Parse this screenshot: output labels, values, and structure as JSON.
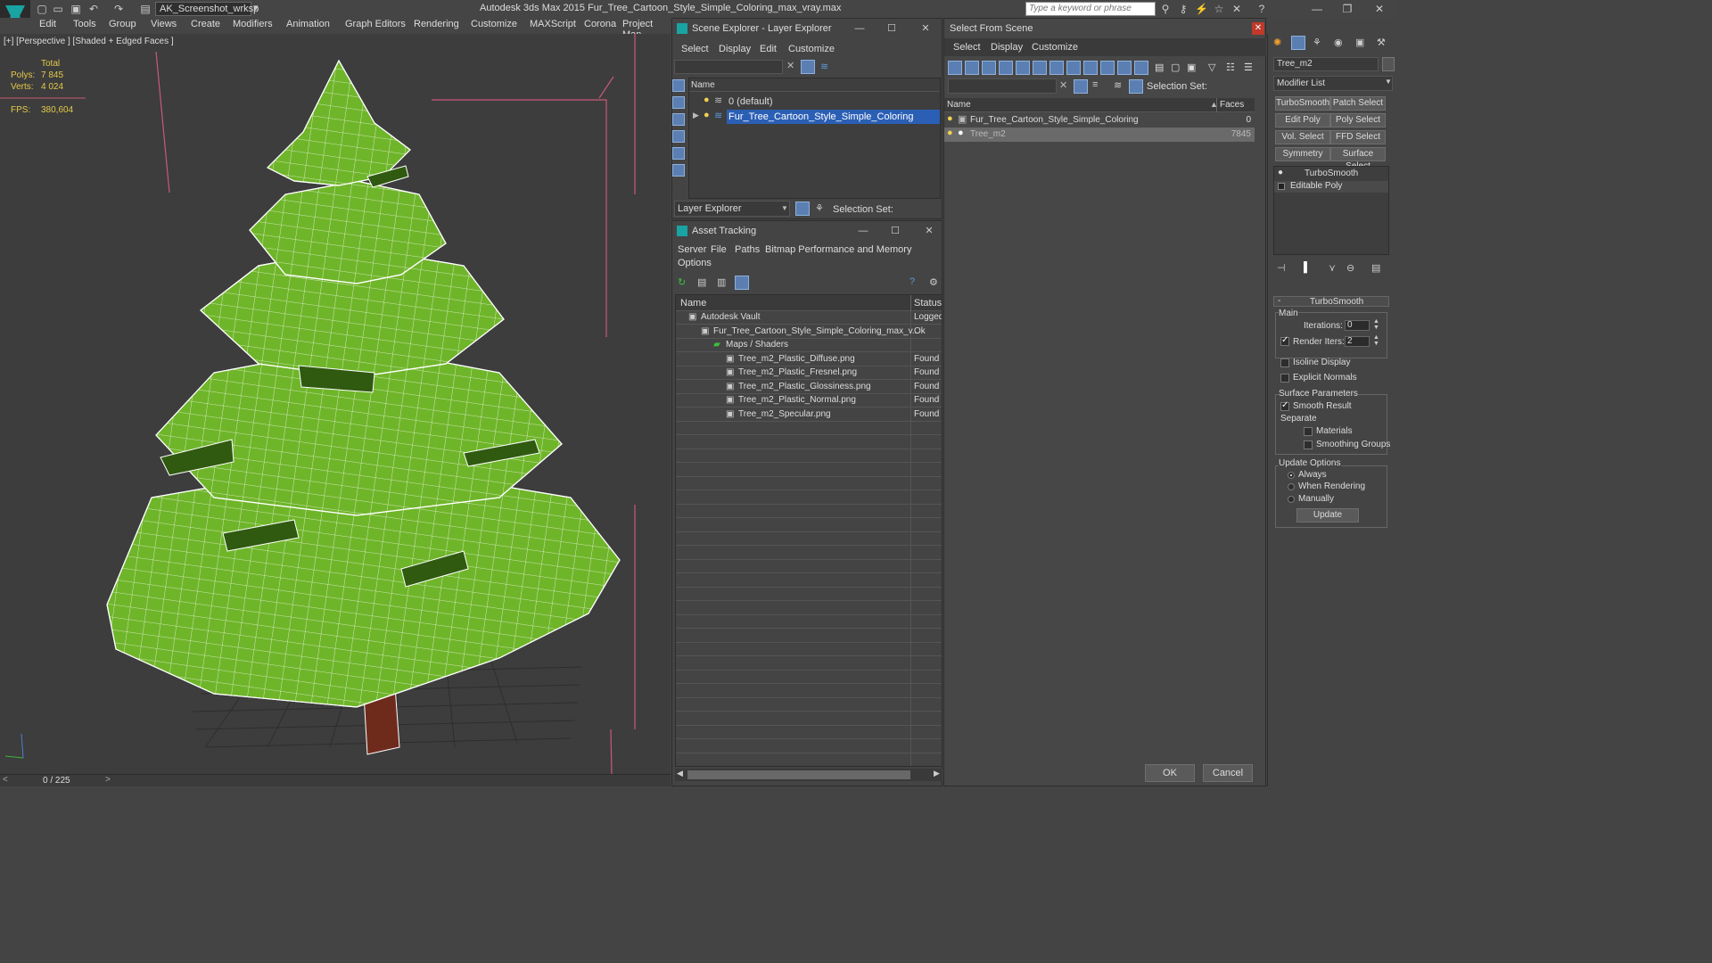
{
  "app": {
    "title": "Autodesk 3ds Max  2015    Fur_Tree_Cartoon_Style_Simple_Coloring_max_vray.max",
    "workspace": "AK_Screenshot_wrksp",
    "search_placeholder": "Type a keyword or phrase"
  },
  "menu": [
    "Edit",
    "Tools",
    "Group",
    "Views",
    "Create",
    "Modifiers",
    "Animation",
    "Graph Editors",
    "Rendering",
    "Customize",
    "MAXScript",
    "Corona",
    "Project Man"
  ],
  "viewport": {
    "label": "[+] [Perspective ] [Shaded + Edged Faces ]",
    "stats_total": "Total",
    "polys_label": "Polys:",
    "polys_value": "7 845",
    "verts_label": "Verts:",
    "verts_value": "4 024",
    "fps_label": "FPS:",
    "fps_value": "380,604",
    "frame": "0 / 225"
  },
  "scene_explorer": {
    "title": "Scene Explorer - Layer Explorer",
    "menus": [
      "Select",
      "Display",
      "Edit",
      "Customize"
    ],
    "col_name": "Name",
    "layers": [
      "0 (default)",
      "Fur_Tree_Cartoon_Style_Simple_Coloring"
    ],
    "footer_dropdown": "Layer Explorer",
    "selection_set": "Selection Set:"
  },
  "asset_tracking": {
    "title": "Asset Tracking",
    "menus": [
      "Server",
      "File",
      "Paths",
      "Bitmap Performance and Memory",
      "Options"
    ],
    "col_name": "Name",
    "col_status": "Status",
    "rows": [
      {
        "name": "Autodesk Vault",
        "status": "Logged"
      },
      {
        "name": "Fur_Tree_Cartoon_Style_Simple_Coloring_max_v...",
        "status": "Ok"
      },
      {
        "name": "Maps / Shaders",
        "status": ""
      },
      {
        "name": "Tree_m2_Plastic_Diffuse.png",
        "status": "Found"
      },
      {
        "name": "Tree_m2_Plastic_Fresnel.png",
        "status": "Found"
      },
      {
        "name": "Tree_m2_Plastic_Glossiness.png",
        "status": "Found"
      },
      {
        "name": "Tree_m2_Plastic_Normal.png",
        "status": "Found"
      },
      {
        "name": "Tree_m2_Specular.png",
        "status": "Found"
      }
    ]
  },
  "select_from_scene": {
    "title": "Select From Scene",
    "menus": [
      "Select",
      "Display",
      "Customize"
    ],
    "selection_set": "Selection Set:",
    "col_name": "Name",
    "col_faces": "Faces",
    "rows": [
      {
        "name": "Fur_Tree_Cartoon_Style_Simple_Coloring",
        "faces": "0"
      },
      {
        "name": "Tree_m2",
        "faces": "7845"
      }
    ],
    "ok": "OK",
    "cancel": "Cancel"
  },
  "command_panel": {
    "object_name": "Tree_m2",
    "modifier_list": "Modifier List",
    "mod_buttons": [
      "TurboSmooth",
      "Patch Select",
      "Edit Poly",
      "Poly Select",
      "Vol. Select",
      "FFD Select",
      "Symmetry",
      "Surface Select"
    ],
    "stack": [
      "TurboSmooth",
      "Editable Poly"
    ],
    "rollout": "TurboSmooth",
    "main": "Main",
    "iterations_label": "Iterations:",
    "iterations": "0",
    "render_iters_label": "Render Iters:",
    "render_iters": "2",
    "isoline": "Isoline Display",
    "explicit_normals": "Explicit Normals",
    "surface_params": "Surface Parameters",
    "smooth_result": "Smooth Result",
    "separate": "Separate",
    "materials": "Materials",
    "smoothing_groups": "Smoothing Groups",
    "update_options": "Update Options",
    "always": "Always",
    "when_rendering": "When Rendering",
    "manually": "Manually",
    "update": "Update"
  },
  "colors": {
    "tree_green": "#6fb52a",
    "tree_dark": "#2f5a10",
    "trunk": "#6e2b1c",
    "selection_blue": "#2b5fb5",
    "stat_yellow": "#e5c94a"
  }
}
